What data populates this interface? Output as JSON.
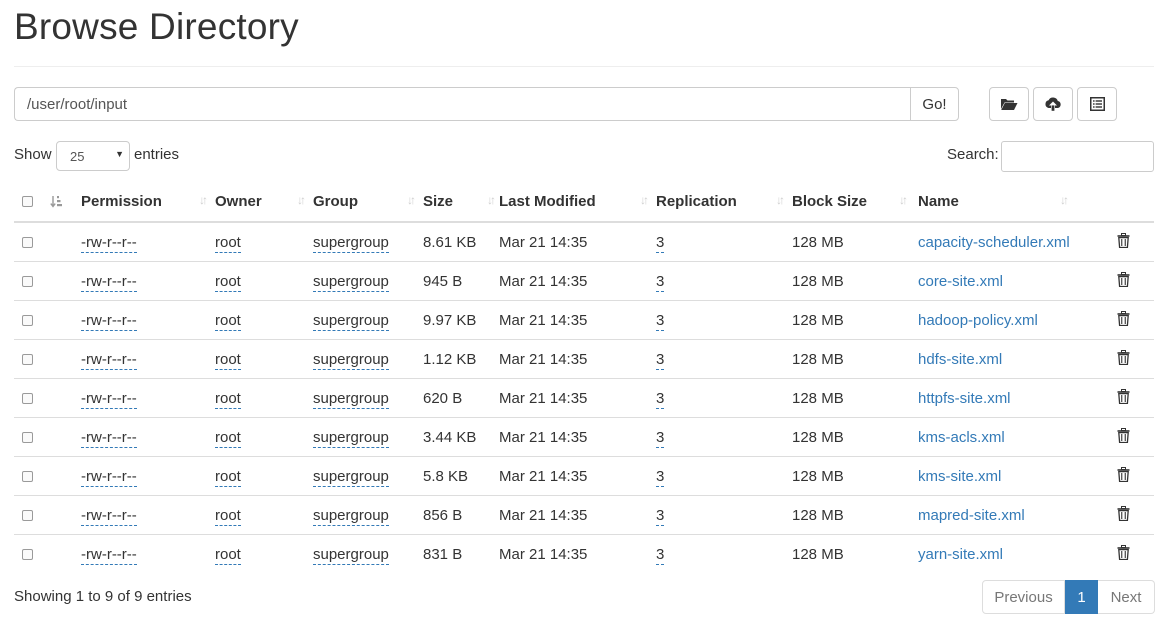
{
  "page": {
    "title": "Browse Directory"
  },
  "path": {
    "value": "/user/root/input",
    "go_label": "Go!"
  },
  "toolbar": {
    "create_dir_icon": "folder-open-icon",
    "upload_icon": "cloud-upload-icon",
    "cut_paste_icon": "list-alt-icon"
  },
  "controls": {
    "show_label": "Show",
    "entries_value": "25",
    "entries_label": "entries",
    "search_label": "Search:",
    "search_value": ""
  },
  "table": {
    "columns": [
      "Permission",
      "Owner",
      "Group",
      "Size",
      "Last Modified",
      "Replication",
      "Block Size",
      "Name"
    ],
    "rows": [
      {
        "permission": "-rw-r--r--",
        "owner": "root",
        "group": "supergroup",
        "size": "8.61 KB",
        "modified": "Mar 21 14:35",
        "replication": "3",
        "block_size": "128 MB",
        "name": "capacity-scheduler.xml"
      },
      {
        "permission": "-rw-r--r--",
        "owner": "root",
        "group": "supergroup",
        "size": "945 B",
        "modified": "Mar 21 14:35",
        "replication": "3",
        "block_size": "128 MB",
        "name": "core-site.xml"
      },
      {
        "permission": "-rw-r--r--",
        "owner": "root",
        "group": "supergroup",
        "size": "9.97 KB",
        "modified": "Mar 21 14:35",
        "replication": "3",
        "block_size": "128 MB",
        "name": "hadoop-policy.xml"
      },
      {
        "permission": "-rw-r--r--",
        "owner": "root",
        "group": "supergroup",
        "size": "1.12 KB",
        "modified": "Mar 21 14:35",
        "replication": "3",
        "block_size": "128 MB",
        "name": "hdfs-site.xml"
      },
      {
        "permission": "-rw-r--r--",
        "owner": "root",
        "group": "supergroup",
        "size": "620 B",
        "modified": "Mar 21 14:35",
        "replication": "3",
        "block_size": "128 MB",
        "name": "httpfs-site.xml"
      },
      {
        "permission": "-rw-r--r--",
        "owner": "root",
        "group": "supergroup",
        "size": "3.44 KB",
        "modified": "Mar 21 14:35",
        "replication": "3",
        "block_size": "128 MB",
        "name": "kms-acls.xml"
      },
      {
        "permission": "-rw-r--r--",
        "owner": "root",
        "group": "supergroup",
        "size": "5.8 KB",
        "modified": "Mar 21 14:35",
        "replication": "3",
        "block_size": "128 MB",
        "name": "kms-site.xml"
      },
      {
        "permission": "-rw-r--r--",
        "owner": "root",
        "group": "supergroup",
        "size": "856 B",
        "modified": "Mar 21 14:35",
        "replication": "3",
        "block_size": "128 MB",
        "name": "mapred-site.xml"
      },
      {
        "permission": "-rw-r--r--",
        "owner": "root",
        "group": "supergroup",
        "size": "831 B",
        "modified": "Mar 21 14:35",
        "replication": "3",
        "block_size": "128 MB",
        "name": "yarn-site.xml"
      }
    ]
  },
  "footer": {
    "info": "Showing 1 to 9 of 9 entries",
    "previous_label": "Previous",
    "current_page": "1",
    "next_label": "Next"
  },
  "colors": {
    "link": "#337ab7",
    "border": "#dddddd",
    "active_page": "#337ab7"
  }
}
